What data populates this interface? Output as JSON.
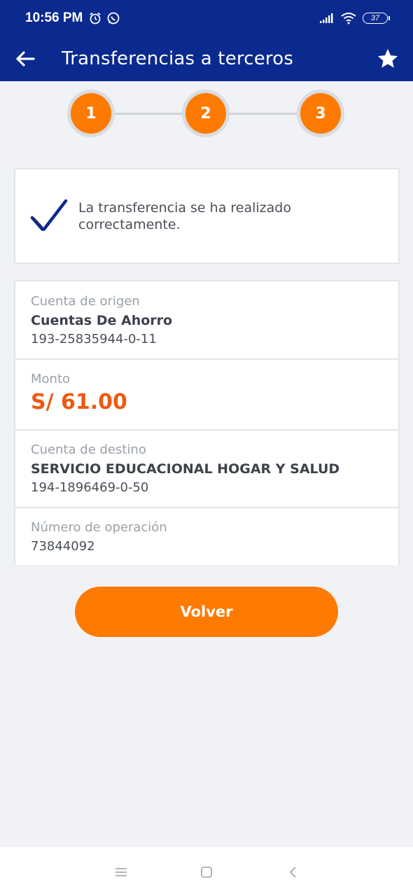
{
  "status_bar": {
    "time": "10:56 PM",
    "battery": "37",
    "icons": [
      "alarm-icon",
      "whatsapp-icon",
      "signal-icon",
      "wifi-icon",
      "battery-icon"
    ]
  },
  "app_bar": {
    "title": "Transferencias a terceros",
    "back_icon": "arrow-left-icon",
    "favorite_icon": "star-icon"
  },
  "stepper": {
    "steps": [
      "1",
      "2",
      "3"
    ]
  },
  "success": {
    "message": "La transferencia se ha realizado correctamente."
  },
  "details": {
    "origin": {
      "label": "Cuenta de origen",
      "name": "Cuentas De Ahorro",
      "number": "193-25835944-0-11"
    },
    "amount": {
      "label": "Monto",
      "value": "S/ 61.00"
    },
    "destination": {
      "label": "Cuenta de destino",
      "name": "SERVICIO EDUCACIONAL HOGAR Y SALUD",
      "number": "194-1896469-0-50"
    },
    "operation": {
      "label": "Número de operación",
      "value": "73844092"
    }
  },
  "actions": {
    "back_label": "Volver"
  },
  "colors": {
    "primary": "#0a2a8f",
    "accent": "#ff7a00",
    "amount": "#ee5a10",
    "background": "#f0f2f5"
  }
}
